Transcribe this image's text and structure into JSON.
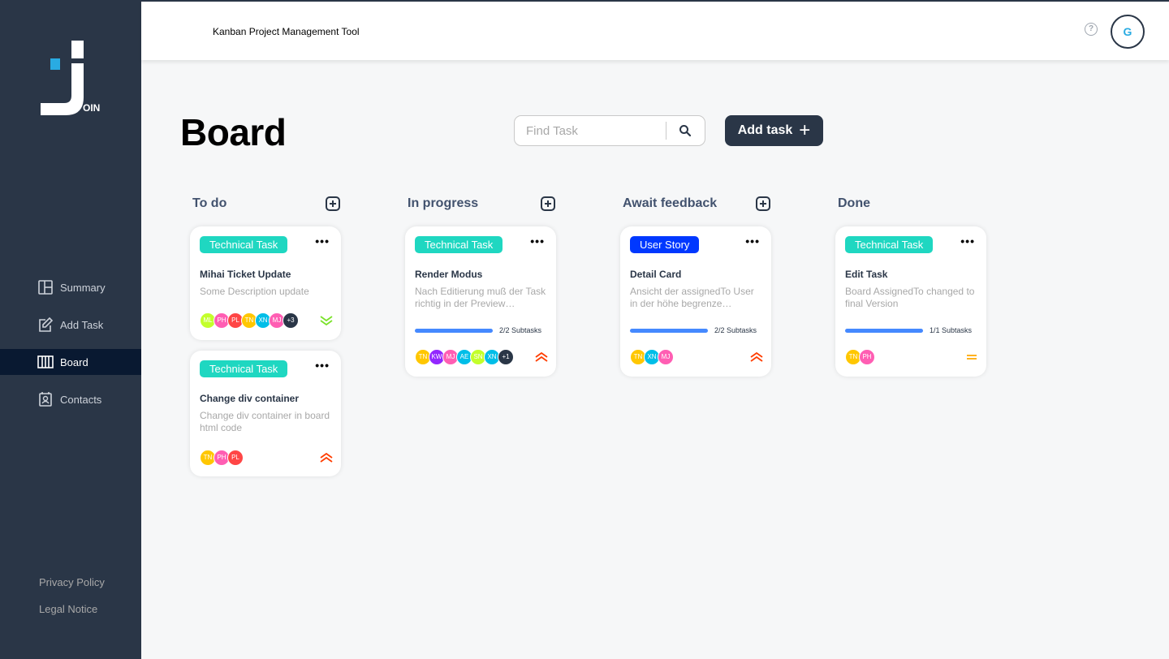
{
  "header": {
    "title": "Kanban Project Management Tool",
    "help": "?",
    "user_initial": "G"
  },
  "logo": {
    "letters": "OIN"
  },
  "sidebar": {
    "items": [
      {
        "label": "Summary",
        "icon": "summary-icon"
      },
      {
        "label": "Add Task",
        "icon": "add-task-icon"
      },
      {
        "label": "Board",
        "icon": "board-icon",
        "active": true
      },
      {
        "label": "Contacts",
        "icon": "contacts-icon"
      }
    ],
    "legal": [
      "Privacy Policy",
      "Legal Notice"
    ]
  },
  "board": {
    "title": "Board",
    "search_placeholder": "Find Task",
    "add_task_label": "Add task",
    "add_task_symbol": "+"
  },
  "columns": [
    {
      "title": "To do"
    },
    {
      "title": "In progress"
    },
    {
      "title": "Await feedback"
    },
    {
      "title": "Done"
    }
  ],
  "cards": {
    "todo1": {
      "tag": "Technical Task",
      "tag_color": "#1FD7C1",
      "title": "Mihai Ticket Update",
      "desc": "Some Description update",
      "avatars": [
        {
          "initials": "ML",
          "color": "#C3FF2B"
        },
        {
          "initials": "PH",
          "color": "#FF5EB3"
        },
        {
          "initials": "PL",
          "color": "#FF4646"
        },
        {
          "initials": "TN",
          "color": "#FFC701"
        },
        {
          "initials": "XN",
          "color": "#00BEE8"
        },
        {
          "initials": "MJ",
          "color": "#FF5EB3"
        },
        {
          "initials": "+3",
          "color": "#2A3647"
        }
      ],
      "priority": "low"
    },
    "todo2": {
      "tag": "Technical Task",
      "tag_color": "#1FD7C1",
      "title": "Change div container",
      "desc": "Change div container in board html code",
      "avatars": [
        {
          "initials": "TN",
          "color": "#FFC701"
        },
        {
          "initials": "PH",
          "color": "#FF5EB3"
        },
        {
          "initials": "PL",
          "color": "#FF4646"
        }
      ],
      "priority": "urgent"
    },
    "progress1": {
      "tag": "Technical Task",
      "tag_color": "#1FD7C1",
      "title": "Render Modus",
      "desc": "Nach Editierung muß der Task richtig in der Preview…",
      "subtasks": "2/2 Subtasks",
      "progress": 1.0,
      "avatars": [
        {
          "initials": "TN",
          "color": "#FFC701"
        },
        {
          "initials": "KW",
          "color": "#9327FF"
        },
        {
          "initials": "MJ",
          "color": "#FF5EB3"
        },
        {
          "initials": "AE",
          "color": "#00BEE8"
        },
        {
          "initials": "SN",
          "color": "#C3FF2B"
        },
        {
          "initials": "XN",
          "color": "#00BEE8"
        },
        {
          "initials": "+1",
          "color": "#2A3647"
        }
      ],
      "priority": "urgent"
    },
    "feedback1": {
      "tag": "User Story",
      "tag_color": "#0038FF",
      "title": "Detail Card",
      "desc": "Ansicht der assignedTo User in der höhe begrenze…",
      "subtasks": "2/2 Subtasks",
      "progress": 1.0,
      "avatars": [
        {
          "initials": "TN",
          "color": "#FFC701"
        },
        {
          "initials": "XN",
          "color": "#00BEE8"
        },
        {
          "initials": "MJ",
          "color": "#FF5EB3"
        }
      ],
      "priority": "urgent"
    },
    "done1": {
      "tag": "Technical Task",
      "tag_color": "#1FD7C1",
      "title": "Edit Task",
      "desc": "Board AssignedTo changed to final Version",
      "subtasks": "1/1 Subtasks",
      "progress": 1.0,
      "avatars": [
        {
          "initials": "TN",
          "color": "#FFC701"
        },
        {
          "initials": "PH",
          "color": "#FF5EB3"
        }
      ],
      "priority": "medium"
    }
  },
  "menu_dots": "•••",
  "colors": {
    "sidebar": "#2A3647",
    "active_nav": "#091931",
    "accent": "#29ABE2",
    "progress": "#4589FF"
  }
}
